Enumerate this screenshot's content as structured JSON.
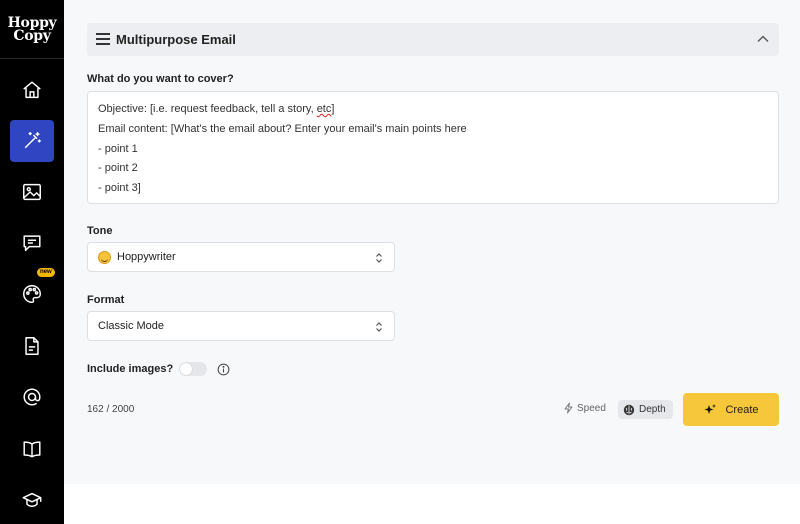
{
  "sidebar": {
    "logo_line1": "Hoppy",
    "logo_line2": "Copy",
    "items": [
      {
        "icon": "home-icon"
      },
      {
        "icon": "magic-wand-icon",
        "active": true
      },
      {
        "icon": "image-icon"
      },
      {
        "icon": "chat-icon"
      },
      {
        "icon": "palette-icon",
        "badge": "new"
      },
      {
        "icon": "document-icon"
      },
      {
        "icon": "at-sign-icon"
      },
      {
        "icon": "book-icon"
      },
      {
        "icon": "graduation-cap-icon"
      }
    ]
  },
  "panel": {
    "title": "Multipurpose Email"
  },
  "form": {
    "cover_label": "What do you want to cover?",
    "cover_lines": [
      "Objective: [i.e. request feedback, tell a story, ",
      "etc",
      "]",
      "Email content: [What's the email about? Enter your email's main points here",
      "- point 1",
      "- point 2",
      "- point 3]"
    ],
    "tone_label": "Tone",
    "tone_value": "Hoppywriter",
    "format_label": "Format",
    "format_value": "Classic Mode",
    "images_label": "Include images?",
    "images_enabled": false
  },
  "footer": {
    "counter": "162 / 2000",
    "speed_label": "Speed",
    "depth_label": "Depth",
    "create_label": "Create"
  },
  "colors": {
    "active_nav": "#2f45c2",
    "create_button": "#f7c73b",
    "badge": "#f5b800"
  }
}
